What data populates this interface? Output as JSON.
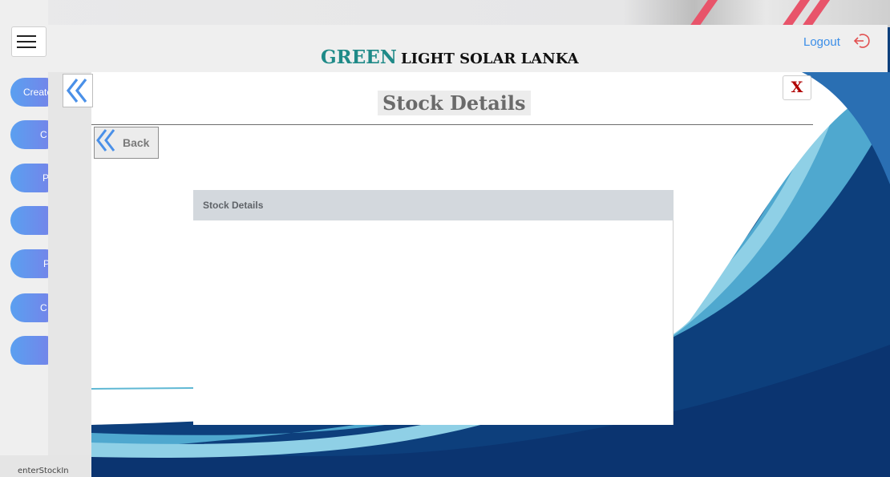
{
  "taskbar": {
    "text": "enterStockIn"
  },
  "sidebar": {
    "menu_icon": "hamburger-icon",
    "items": [
      {
        "label": "Create"
      },
      {
        "label": "C"
      },
      {
        "label": "P"
      },
      {
        "label": ""
      },
      {
        "label": "P"
      },
      {
        "label": "C"
      },
      {
        "label": ""
      }
    ]
  },
  "header": {
    "brand_green": "GREEN",
    "brand_rest": "LIGHT SOLAR LANKA",
    "logout_label": "Logout",
    "logout_icon": "logout-icon"
  },
  "toolbar": {
    "collapse_icon": "double-chevron-left-icon",
    "close_label": "X"
  },
  "page": {
    "title": "Stock Details",
    "back_label": "Back",
    "back_icon": "double-chevron-left-icon"
  },
  "card": {
    "title": "Stock Details"
  },
  "colors": {
    "brand_green": "#1f8a88",
    "logout_blue": "#3b8ee8",
    "logout_icon_red": "#e25050",
    "close_red": "#b00000",
    "accent_blue": "#4a90e8",
    "background_navy": "#0d3f7c",
    "stripe_pink": "#e8546a"
  }
}
